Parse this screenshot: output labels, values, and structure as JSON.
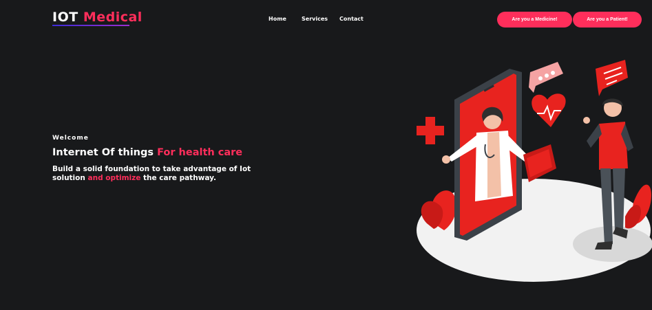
{
  "header": {
    "logo_part1": "IOT",
    "logo_part2": "Medical",
    "nav": [
      "Home",
      "Services",
      "Contact"
    ],
    "cta_medicine": "Are you a Medicine!",
    "cta_patient": "Are you a Patient!"
  },
  "hero": {
    "eyebrow": "Welcome",
    "headline_plain": "Internet Of things",
    "headline_accent": "For health care",
    "sub_part1": "Build a solid foundation to take advantage of Iot solution",
    "sub_accent": "and optimize",
    "sub_part2": "the care pathway."
  },
  "colors": {
    "background": "#18191b",
    "accent": "#ff2e5b",
    "illustration_red": "#e8231f",
    "text": "#ffffff"
  },
  "illustration": {
    "icons": [
      "phone-icon",
      "doctor-icon",
      "patient-icon",
      "heart-icon",
      "cross-icon",
      "chat-bubble-icon",
      "clipboard-icon",
      "leaf-icon"
    ]
  }
}
